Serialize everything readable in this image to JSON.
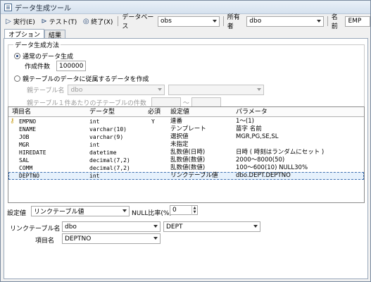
{
  "window": {
    "title": "データ生成ツール"
  },
  "toolbar": {
    "execute_label": "実行(E)",
    "test_label": "テスト(T)",
    "exit_label": "終了(X)",
    "database_label": "データベース",
    "database_value": "obs",
    "owner_label": "所有者",
    "owner_value": "dbo",
    "name_label": "名前",
    "name_value": "EMP"
  },
  "tabs": [
    {
      "label": "オプション",
      "active": true
    },
    {
      "label": "結果",
      "active": false
    }
  ],
  "generation": {
    "group_label": "データ生成方法",
    "normal_label": "通常のデータ生成",
    "count_label": "作成件数",
    "count_value": "100000",
    "parent_label": "親テーブルのデータに従属するデータを作成",
    "parent_table_label": "親テーブル名",
    "parent_table_value": "dbo",
    "per_row_label": "親テーブル１件あたりの子テーブルの件数",
    "range_sep": "〜"
  },
  "grid": {
    "headers": {
      "item": "項目名",
      "type": "データ型",
      "required": "必須",
      "setting": "設定値",
      "param": "パラメータ"
    },
    "rows": [
      {
        "item": "EMPNO",
        "type": "int",
        "required": "Y",
        "setting": "連番",
        "param": "1〜(1)",
        "key": true
      },
      {
        "item": "ENAME",
        "type": "varchar(10)",
        "required": "",
        "setting": "テンプレート",
        "param": "苗字 名前",
        "key": false
      },
      {
        "item": "JOB",
        "type": "varchar(9)",
        "required": "",
        "setting": "選択値",
        "param": "MGR,PG,SE,SL",
        "key": false
      },
      {
        "item": "MGR",
        "type": "int",
        "required": "",
        "setting": "未指定",
        "param": "",
        "key": false
      },
      {
        "item": "HIREDATE",
        "type": "datetime",
        "required": "",
        "setting": "乱数値(日時)",
        "param": "日時 ( 時刻はランダムにセット )",
        "key": false
      },
      {
        "item": "SAL",
        "type": "decimal(7,2)",
        "required": "",
        "setting": "乱数値(数値)",
        "param": "2000〜8000(50)",
        "key": false
      },
      {
        "item": "COMM",
        "type": "decimal(7,2)",
        "required": "",
        "setting": "乱数値(数値)",
        "param": "100〜600(10) NULL30%",
        "key": false
      },
      {
        "item": "DEPTNO",
        "type": "int",
        "required": "",
        "setting": "リンクテーブル値",
        "param": "dbo.DEPT.DEPTNO",
        "key": false,
        "selected": true
      }
    ]
  },
  "settings": {
    "setting_label": "設定値",
    "setting_value": "リンクテーブル値",
    "null_ratio_label": "NULL比率(%)",
    "null_ratio_value": "0",
    "link_table_label": "リンクテーブル名",
    "link_owner_value": "dbo",
    "link_table_value": "DEPT",
    "item_label": "項目名",
    "item_value": "DEPTNO"
  }
}
